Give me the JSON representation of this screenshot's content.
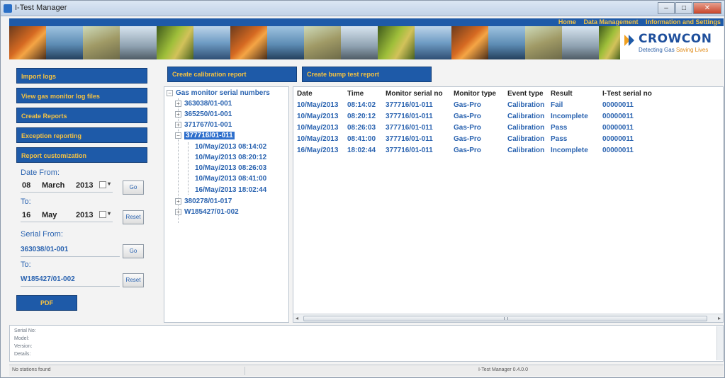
{
  "window": {
    "title": "I-Test Manager",
    "controls": [
      "–",
      "□",
      "✕"
    ]
  },
  "top_nav": {
    "links": [
      "Home",
      "Data Management",
      "Information and Settings"
    ]
  },
  "brand": {
    "name": "CROWCON",
    "tagline_a": "Detecting Gas",
    "tagline_b": "Saving Lives",
    "colors": {
      "primary": "#1e5aa8",
      "accent": "#f0a020"
    }
  },
  "sidebar": {
    "buttons": [
      "Import logs",
      "View gas monitor log files",
      "Create Reports",
      "Exception reporting",
      "Report customization"
    ],
    "date_from_label": "Date From:",
    "date_from": {
      "day": "08",
      "month": "March",
      "year": "2013"
    },
    "date_from_go": "Go",
    "date_to_label": "To:",
    "date_to": {
      "day": "16",
      "month": "May",
      "year": "2013"
    },
    "date_to_reset": "Reset",
    "serial_from_label": "Serial From:",
    "serial_from": "363038/01-001",
    "serial_from_go": "Go",
    "serial_to_label": "To:",
    "serial_to": "W185427/01-002",
    "serial_to_reset": "Reset",
    "run_button": "PDF"
  },
  "toolbar": {
    "create_calibration_report": "Create calibration report",
    "create_bump_test_report": "Create bump test report"
  },
  "tree": {
    "root": "Gas monitor serial numbers",
    "nodes_before": [
      "363038/01-001",
      "365250/01-001",
      "371767/01-001"
    ],
    "expanded": "377716/01-011",
    "children": [
      "10/May/2013 08:14:02",
      "10/May/2013 08:20:12",
      "10/May/2013 08:26:03",
      "10/May/2013 08:41:00",
      "16/May/2013 18:02:44"
    ],
    "nodes_after": [
      "380278/01-017",
      "W185427/01-002"
    ]
  },
  "table": {
    "columns": [
      "Date",
      "Time",
      "Monitor serial no",
      "Monitor type",
      "Event type",
      "Result",
      "I-Test serial no"
    ],
    "rows": [
      [
        "10/May/2013",
        "08:14:02",
        "377716/01-011",
        "Gas-Pro",
        "Calibration",
        "Fail",
        "00000011"
      ],
      [
        "10/May/2013",
        "08:20:12",
        "377716/01-011",
        "Gas-Pro",
        "Calibration",
        "Incomplete",
        "00000011"
      ],
      [
        "10/May/2013",
        "08:26:03",
        "377716/01-011",
        "Gas-Pro",
        "Calibration",
        "Pass",
        "00000011"
      ],
      [
        "10/May/2013",
        "08:41:00",
        "377716/01-011",
        "Gas-Pro",
        "Calibration",
        "Pass",
        "00000011"
      ],
      [
        "16/May/2013",
        "18:02:44",
        "377716/01-011",
        "Gas-Pro",
        "Calibration",
        "Incomplete",
        "00000011"
      ]
    ]
  },
  "info_pane": {
    "labels": [
      "Serial No:",
      "Model:",
      "Version:",
      "Details:"
    ]
  },
  "status": {
    "left": "No stations found",
    "center": "I-Test Manager 0.4.0.0"
  }
}
